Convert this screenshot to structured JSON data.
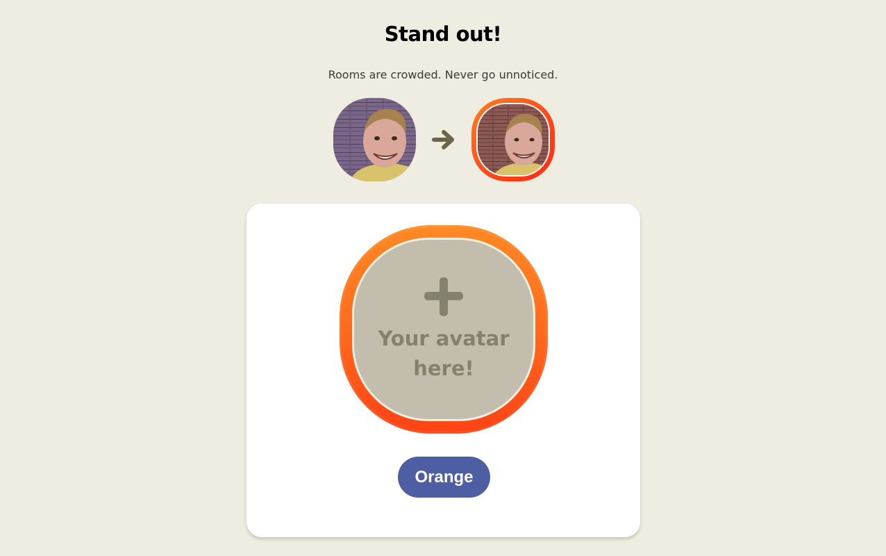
{
  "header": {
    "title": "Stand out!",
    "subtitle": "Rooms are crowded. Never go unnoticed."
  },
  "preview": {
    "before_avatar": "avatar-photo",
    "arrow_icon": "arrow-right-icon",
    "after_avatar": "avatar-photo-with-ring"
  },
  "editor": {
    "placeholder_icon": "plus-icon",
    "placeholder_text": "Your avatar\nhere!",
    "color_button_label": "Orange"
  },
  "colors": {
    "background": "#efece1",
    "ring_orange": "#ff6a1c",
    "ring_red": "#ff3a14",
    "button": "#4d5ea2",
    "slot_fill": "#c2bdac",
    "slot_text": "#85816f"
  }
}
